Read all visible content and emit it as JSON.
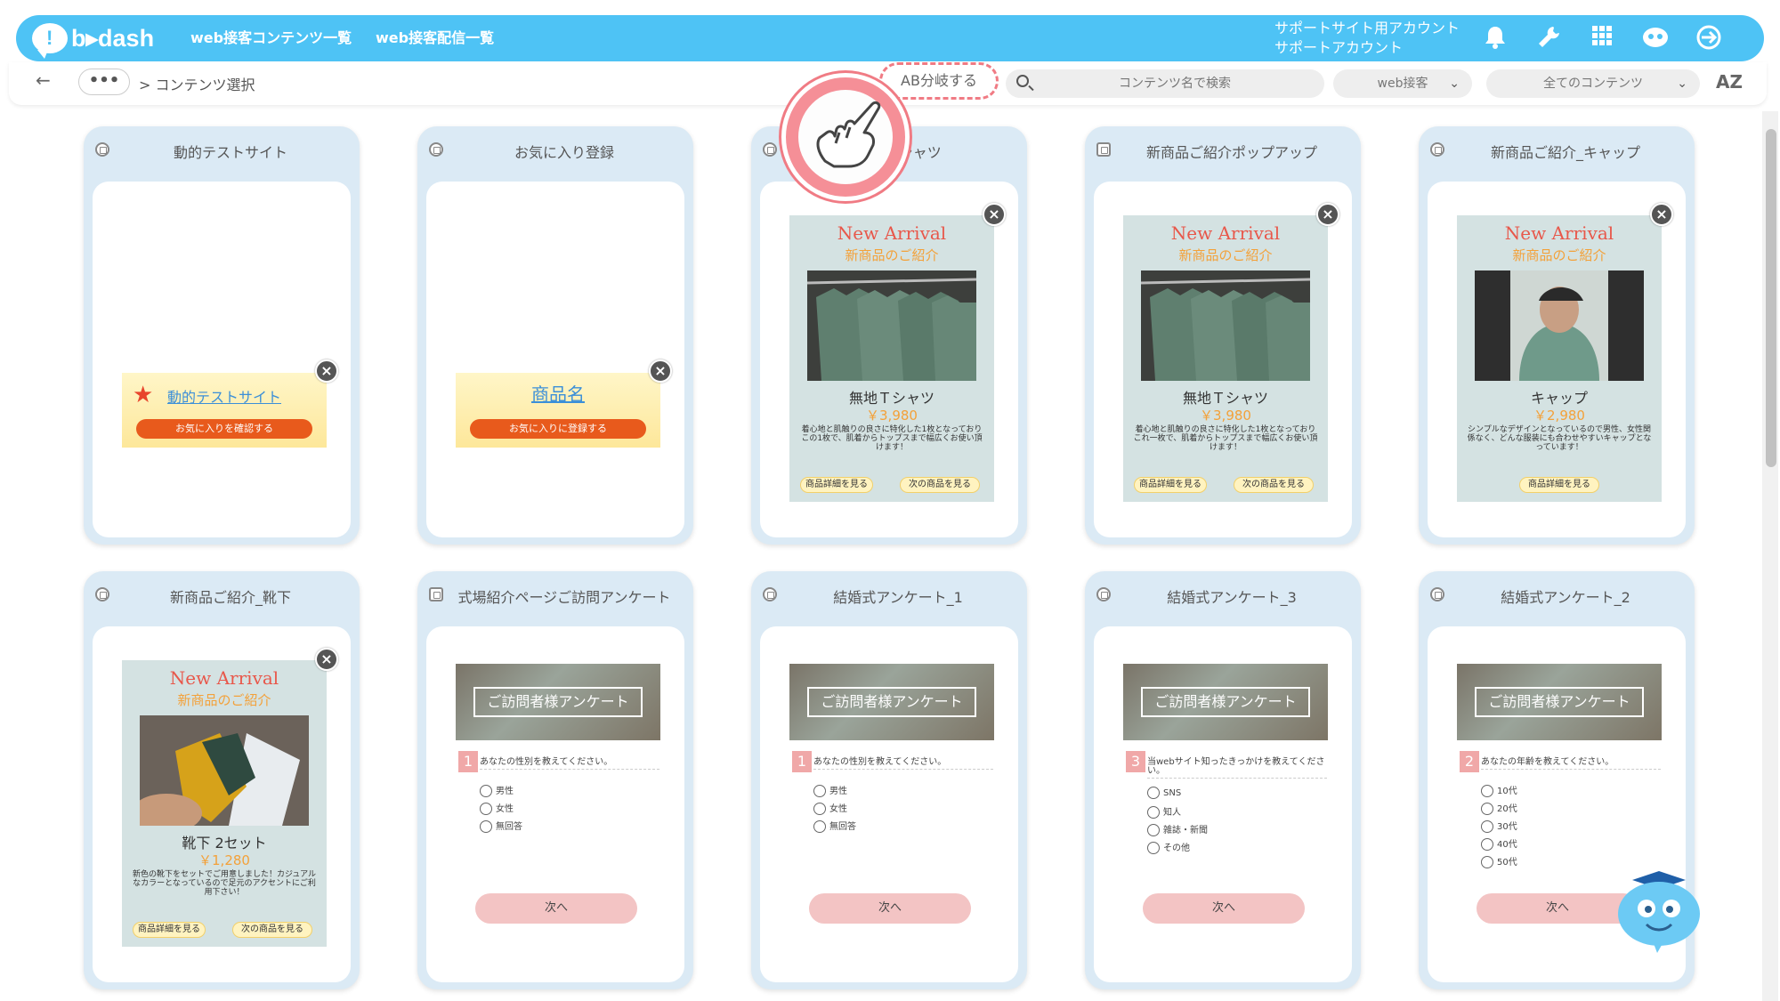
{
  "header": {
    "logo_text": "b▸dash",
    "nav": [
      "web接客コンテンツ一覧",
      "web接客配信一覧"
    ],
    "account_line1": "サポートサイト用アカウント",
    "account_line2": "サポートアカウント"
  },
  "toolbar": {
    "more_label": "•••",
    "breadcrumb": "> コンテンツ選択",
    "ab_label": "AB分岐する",
    "search_placeholder": "コンテンツ名で検索",
    "type_select": "web接客",
    "filter_select": "全てのコンテンツ",
    "sort_label": "AZ"
  },
  "cards": [
    {
      "title": "動的テストサイト",
      "banner_link": "動的テストサイト",
      "banner_button": "お気に入りを確認する"
    },
    {
      "title": "お気に入り登録",
      "banner_link": "商品名",
      "banner_button": "お気に入りに登録する"
    },
    {
      "title": "地Tシャツ",
      "heading": "New Arrival",
      "sub": "新商品のご紹介",
      "name": "無地Ｔシャツ",
      "price": "￥3,980",
      "desc": "着心地と肌触りの良さに特化した1枚となっており この1枚で、肌着からトップスまで幅広くお使い頂けます！",
      "btn1": "商品詳細を見る",
      "btn2": "次の商品を見る"
    },
    {
      "title": "新商品ご紹介ポップアップ",
      "heading": "New Arrival",
      "sub": "新商品のご紹介",
      "name": "無地Ｔシャツ",
      "price": "￥3,980",
      "desc": "着心地と肌触りの良さに特化した1枚となっており これ一枚で、肌着からトップスまで幅広くお使い頂けます！",
      "btn1": "商品詳細を見る",
      "btn2": "次の商品を見る"
    },
    {
      "title": "新商品ご紹介_キャップ",
      "heading": "New Arrival",
      "sub": "新商品のご紹介",
      "name": "キャップ",
      "price": "￥2,980",
      "desc": "シンプルなデザインとなっているので男性、女性関係なく、どんな服装にも合わせやすいキャップとなっています！",
      "btn1": "商品詳細を見る"
    },
    {
      "title": "新商品ご紹介_靴下",
      "heading": "New Arrival",
      "sub": "新商品のご紹介",
      "name": "靴下 2セット",
      "price": "￥1,280",
      "desc": "新色の靴下をセットでご用意しました！カジュアルなカラーとなっているので足元のアクセントにご利用下さい！",
      "btn1": "商品詳細を見る",
      "btn2": "次の商品を見る"
    },
    {
      "title": "式場紹介ページご訪問アンケート",
      "survey_title": "ご訪問者様アンケート",
      "qnum": "1",
      "question": "あなたの性別を教えてください。",
      "options": [
        "男性",
        "女性",
        "無回答"
      ],
      "next": "次へ"
    },
    {
      "title": "結婚式アンケート_1",
      "survey_title": "ご訪問者様アンケート",
      "qnum": "1",
      "question": "あなたの性別を教えてください。",
      "options": [
        "男性",
        "女性",
        "無回答"
      ],
      "next": "次へ"
    },
    {
      "title": "結婚式アンケート_3",
      "survey_title": "ご訪問者様アンケート",
      "qnum": "3",
      "question": "当webサイト知ったきっかけを教えてください。",
      "options": [
        "SNS",
        "知人",
        "雑誌・新聞",
        "その他"
      ],
      "next": "次へ"
    },
    {
      "title": "結婚式アンケート_2",
      "survey_title": "ご訪問者様アンケート",
      "qnum": "2",
      "question": "あなたの年齢を教えてください。",
      "options": [
        "10代",
        "20代",
        "30代",
        "40代",
        "50代"
      ],
      "next": "次へ"
    }
  ],
  "colors": {
    "topbar": "#4ec3f5",
    "accent_pink": "#f07b84",
    "card_bg": "#dbeaf5"
  }
}
